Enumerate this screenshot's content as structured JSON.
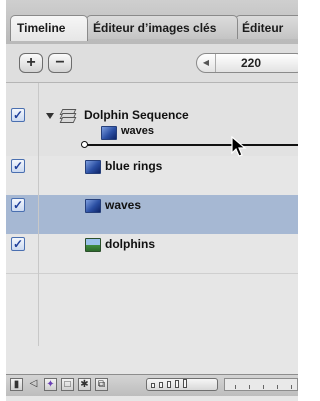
{
  "tabs": [
    {
      "label": "Timeline",
      "active": true
    },
    {
      "label": "Éditeur d’images clés",
      "active": false
    },
    {
      "label": "Éditeur",
      "active": false
    }
  ],
  "toolbar": {
    "add_label": "+",
    "remove_label": "−",
    "time_value": "220"
  },
  "layers": [
    {
      "name": "Dolphin Sequence",
      "icon": "group-layers-icon",
      "checked": true,
      "expanded": true,
      "child": {
        "name": "waves",
        "icon": "video-clip-icon"
      }
    },
    {
      "name": "blue rings",
      "icon": "video-clip-icon",
      "checked": true,
      "selected": false
    },
    {
      "name": "waves",
      "icon": "video-clip-icon",
      "checked": true,
      "selected": true
    },
    {
      "name": "dolphins",
      "icon": "image-icon",
      "checked": true,
      "selected": false
    }
  ],
  "checkbox_glyph": "✓",
  "colors": {
    "selection": "#a6b8d3",
    "checkbox_border": "#4a6fb0",
    "panel": "#e6e6e6"
  }
}
